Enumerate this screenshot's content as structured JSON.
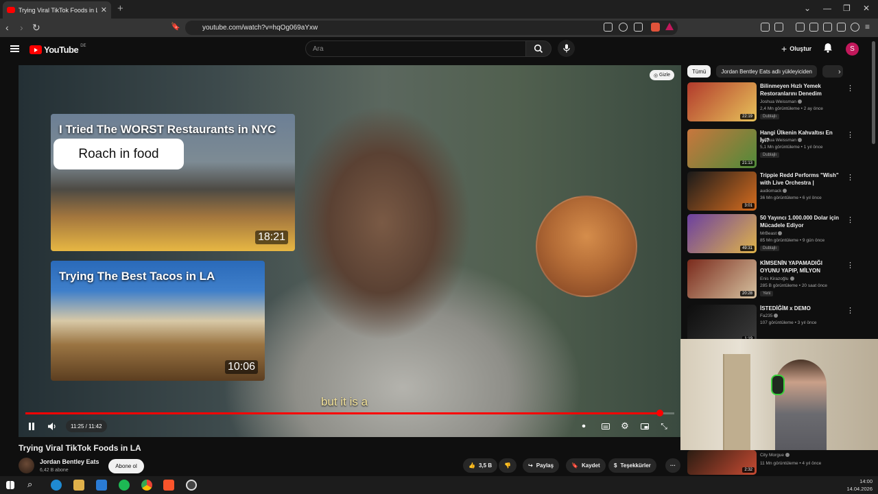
{
  "browser": {
    "tab_title": "Trying Viral TikTok Foods in LA",
    "new_tab": "+",
    "url": "youtube.com/watch?v=hqOg069aYxw"
  },
  "youtube": {
    "logo_text": "YouTube",
    "region": "DE",
    "search_placeholder": "Ara",
    "create_label": "Oluştur",
    "avatar_letter": "S"
  },
  "player": {
    "hide_label": "Gizle",
    "endcards": [
      {
        "title": "I Tried The WORST Restaurants in NYC",
        "tag": "Roach in food",
        "duration": "18:21"
      },
      {
        "title": "Trying The Best Tacos in LA",
        "duration": "10:06"
      }
    ],
    "caption": "but it is a",
    "time": "11:25 / 11:42",
    "progress_fraction": 0.978
  },
  "video": {
    "title": "Trying Viral TikTok Foods in LA",
    "channel": "Jordan Bentley Eats",
    "subscribers": "6,42 B abone",
    "subscribe_label": "Abone ol",
    "likes": "3,5 B",
    "share_label": "Paylaş",
    "save_label": "Kaydet",
    "thanks_label": "Teşekkürler"
  },
  "sidebar": {
    "chips": [
      "Tümü",
      "Jordan Bentley Eats adlı yükleyiciden"
    ],
    "recs": [
      {
        "title": "Bilinmeyen Hızlı Yemek Restoranlarını Denedim",
        "channel": "Joshua Weissman",
        "meta": "2,4 Mn görüntüleme • 2 ay önce",
        "badge": "Dublajlı",
        "duration": "22:19",
        "colors": [
          "#b23a2c",
          "#e7c25a"
        ]
      },
      {
        "title": "Hangi Ülkenin Kahvaltısı En İyi?",
        "channel": "Joshua Weissman",
        "meta": "5,1 Mn görüntüleme • 1 yıl önce",
        "badge": "Dublajlı",
        "duration": "21:13",
        "colors": [
          "#c9763d",
          "#4f8b3a"
        ]
      },
      {
        "title": "Trippie Redd Performs \"Wish\" with Live Orchestra | Audioma...",
        "channel": "audiomack",
        "meta": "36 Mn görüntüleme • 6 yıl önce",
        "badge": "",
        "duration": "3:01",
        "colors": [
          "#1a1a1a",
          "#d76d1f"
        ]
      },
      {
        "title": "50 Yayıncı 1.000.000 Dolar için Mücadele Ediyor",
        "channel": "MrBeast",
        "meta": "85 Mn görüntüleme • 9 gün önce",
        "badge": "Dublajlı",
        "duration": "49:31",
        "colors": [
          "#6b3fa0",
          "#e0b44a"
        ]
      },
      {
        "title": "KİMSENİN YAPAMADIĞI OYUNU YAPIP, MİLYON DOLARLAR ...",
        "channel": "Enis Kirazoğlu",
        "meta": "285 B görüntüleme • 20 saat önce",
        "badge": "Yeni",
        "duration": "20:28",
        "colors": [
          "#7a2a1c",
          "#d6c2a0"
        ]
      },
      {
        "title": "İSTEDİĞİM x DEMO",
        "channel": "Fa235",
        "meta": "107 görüntüleme • 3 yıl önce",
        "badge": "",
        "duration": "1:19",
        "colors": [
          "#0d0d0d",
          "#3b3b3b"
        ]
      }
    ],
    "last_rec": {
      "channel": "City Morgue",
      "meta": "11 Mn görüntüleme • 4 yıl önce",
      "duration": "2:32"
    }
  },
  "taskbar": {
    "time": "14:00",
    "date": "14.04.2026"
  },
  "colors": {
    "accent": "#ff0000",
    "bg": "#0f0f0f",
    "chip": "#272727"
  }
}
